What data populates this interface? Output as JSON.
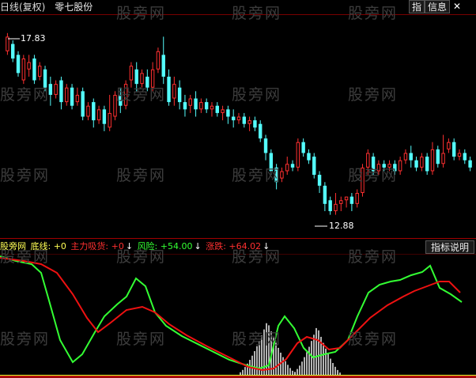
{
  "header": {
    "period": "日线(复权)",
    "stock": "零七股份",
    "btn_index": "指",
    "btn_info": "信息",
    "btn_close": "✕"
  },
  "price_labels": {
    "high": "17.83",
    "low": "12.88"
  },
  "indicator": {
    "name": "股旁网",
    "base_label": "底线: +0",
    "main_label": "主力吸货: +0",
    "risk_label": "风险: +54.00",
    "change_label": "涨跌: +64.02",
    "down_arrow": "↓",
    "help_button": "指标说明"
  },
  "watermark": "股旁网",
  "colors": {
    "up": "#ff3030",
    "down": "#54fcfc",
    "green_line": "#33ff33",
    "red_line": "#ee1111",
    "bars": "#ffffff",
    "yellow": "#ffff33"
  },
  "chart_data": {
    "type": "candlestick",
    "price_high": 17.83,
    "price_low": 12.88,
    "candles": [
      [
        17.4,
        17.8,
        17.3,
        17.9
      ],
      [
        17.6,
        17.2,
        17.1,
        17.7
      ],
      [
        17.3,
        16.8,
        16.7,
        17.4
      ],
      [
        16.6,
        17.2,
        16.5,
        17.3
      ],
      [
        16.9,
        17.1,
        16.7,
        17.3
      ],
      [
        17.2,
        16.6,
        16.5,
        17.3
      ],
      [
        16.7,
        17.0,
        16.6,
        17.1
      ],
      [
        16.9,
        16.4,
        16.3,
        17.0
      ],
      [
        16.5,
        16.2,
        15.9,
        16.7
      ],
      [
        16.2,
        16.5,
        16.1,
        16.6
      ],
      [
        16.6,
        16.0,
        15.8,
        16.7
      ],
      [
        16.0,
        16.4,
        15.9,
        16.5
      ],
      [
        16.4,
        15.9,
        15.8,
        16.5
      ],
      [
        16.0,
        16.2,
        15.9,
        16.4
      ],
      [
        16.3,
        15.6,
        15.5,
        16.4
      ],
      [
        15.6,
        15.9,
        15.5,
        16.0
      ],
      [
        16.0,
        15.5,
        15.3,
        16.1
      ],
      [
        15.5,
        15.8,
        15.4,
        15.9
      ],
      [
        15.8,
        15.4,
        15.2,
        15.9
      ],
      [
        15.3,
        15.7,
        15.2,
        16.2
      ],
      [
        15.6,
        16.2,
        15.5,
        16.3
      ],
      [
        16.2,
        15.9,
        15.7,
        16.4
      ],
      [
        15.9,
        16.5,
        15.8,
        16.6
      ],
      [
        16.6,
        17.0,
        16.4,
        17.1
      ],
      [
        16.9,
        16.5,
        16.3,
        17.1
      ],
      [
        16.5,
        16.8,
        16.4,
        16.9
      ],
      [
        16.7,
        16.4,
        16.3,
        16.9
      ],
      [
        16.4,
        16.9,
        16.3,
        17.1
      ],
      [
        16.9,
        17.4,
        16.8,
        17.5
      ],
      [
        17.3,
        16.7,
        16.5,
        17.8
      ],
      [
        16.7,
        16.0,
        15.9,
        16.9
      ],
      [
        16.1,
        16.5,
        15.9,
        16.7
      ],
      [
        16.4,
        16.0,
        15.8,
        16.6
      ],
      [
        16.0,
        15.8,
        15.6,
        16.2
      ],
      [
        15.9,
        16.1,
        15.7,
        16.2
      ],
      [
        16.1,
        15.8,
        15.6,
        16.3
      ],
      [
        15.8,
        16.0,
        15.7,
        16.1
      ],
      [
        16.0,
        15.8,
        15.7,
        16.1
      ],
      [
        15.8,
        15.9,
        15.6,
        16.0
      ],
      [
        15.9,
        15.7,
        15.6,
        16.0
      ],
      [
        15.7,
        15.8,
        15.5,
        15.9
      ],
      [
        15.8,
        15.6,
        15.4,
        15.9
      ],
      [
        15.6,
        15.5,
        15.3,
        15.8
      ],
      [
        15.5,
        15.6,
        15.4,
        15.7
      ],
      [
        15.6,
        15.4,
        15.3,
        15.7
      ],
      [
        15.4,
        15.5,
        15.2,
        15.6
      ],
      [
        15.5,
        15.3,
        15.2,
        15.6
      ],
      [
        15.4,
        15.0,
        14.9,
        15.5
      ],
      [
        15.0,
        14.6,
        14.4,
        15.1
      ],
      [
        14.6,
        14.1,
        14.0,
        14.7
      ],
      [
        14.2,
        13.8,
        13.6,
        14.3
      ],
      [
        13.9,
        14.1,
        13.8,
        14.2
      ],
      [
        14.1,
        14.3,
        14.0,
        14.5
      ],
      [
        14.3,
        14.2,
        14.1,
        14.4
      ],
      [
        14.2,
        14.9,
        14.1,
        15.0
      ],
      [
        14.9,
        14.6,
        14.5,
        15.0
      ],
      [
        14.6,
        14.4,
        14.3,
        14.7
      ],
      [
        14.5,
        14.0,
        13.9,
        14.6
      ],
      [
        14.0,
        13.7,
        13.5,
        14.1
      ],
      [
        13.7,
        13.2,
        13.0,
        13.8
      ],
      [
        13.3,
        13.0,
        12.9,
        13.4
      ],
      [
        13.0,
        13.2,
        12.9,
        13.5
      ],
      [
        13.2,
        13.3,
        13.0,
        13.4
      ],
      [
        13.3,
        13.4,
        13.1,
        13.4
      ],
      [
        13.4,
        13.2,
        13.0,
        13.5
      ],
      [
        13.2,
        13.5,
        13.1,
        13.6
      ],
      [
        13.5,
        14.2,
        13.4,
        14.3
      ],
      [
        14.2,
        14.6,
        14.0,
        14.7
      ],
      [
        14.5,
        14.1,
        14.0,
        14.6
      ],
      [
        14.1,
        14.3,
        14.0,
        14.4
      ],
      [
        14.3,
        14.2,
        14.1,
        14.4
      ],
      [
        14.2,
        14.3,
        14.1,
        14.4
      ],
      [
        14.3,
        14.1,
        14.0,
        14.4
      ],
      [
        14.1,
        14.4,
        14.0,
        14.5
      ],
      [
        14.4,
        14.6,
        14.3,
        14.7
      ],
      [
        14.6,
        14.4,
        14.2,
        14.8
      ],
      [
        14.4,
        14.2,
        14.1,
        14.5
      ],
      [
        14.2,
        14.5,
        14.1,
        14.6
      ],
      [
        14.5,
        14.1,
        14.0,
        14.6
      ],
      [
        14.1,
        14.7,
        14.0,
        14.9
      ],
      [
        14.7,
        14.3,
        14.2,
        14.8
      ],
      [
        14.3,
        14.6,
        14.2,
        15.1
      ],
      [
        14.7,
        14.9,
        14.6,
        15.0
      ],
      [
        14.9,
        14.5,
        14.4,
        15.0
      ],
      [
        14.5,
        14.6,
        14.4,
        14.7
      ],
      [
        14.6,
        14.4,
        14.3,
        14.7
      ],
      [
        14.4,
        14.2,
        14.1,
        14.5
      ]
    ]
  }
}
